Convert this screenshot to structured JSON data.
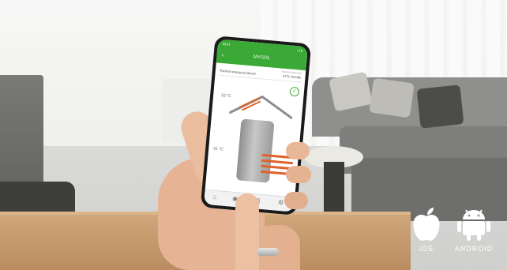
{
  "app": {
    "title": "MYSOL",
    "status_time": "09:41",
    "status_right": "LTE",
    "connection_label": "Internet connection",
    "row_label": "Thermal energy produced",
    "row_value": "4772.78 kWh",
    "temp_top": "22 °C",
    "temp_bottom": "21 °C",
    "accent_color": "#3aa935",
    "coil_color": "#e0622a"
  },
  "badges": {
    "ios_label": "iOS",
    "android_label": "ANDROID",
    "ios_icon": "apple-icon",
    "android_icon": "android-robot-icon"
  }
}
